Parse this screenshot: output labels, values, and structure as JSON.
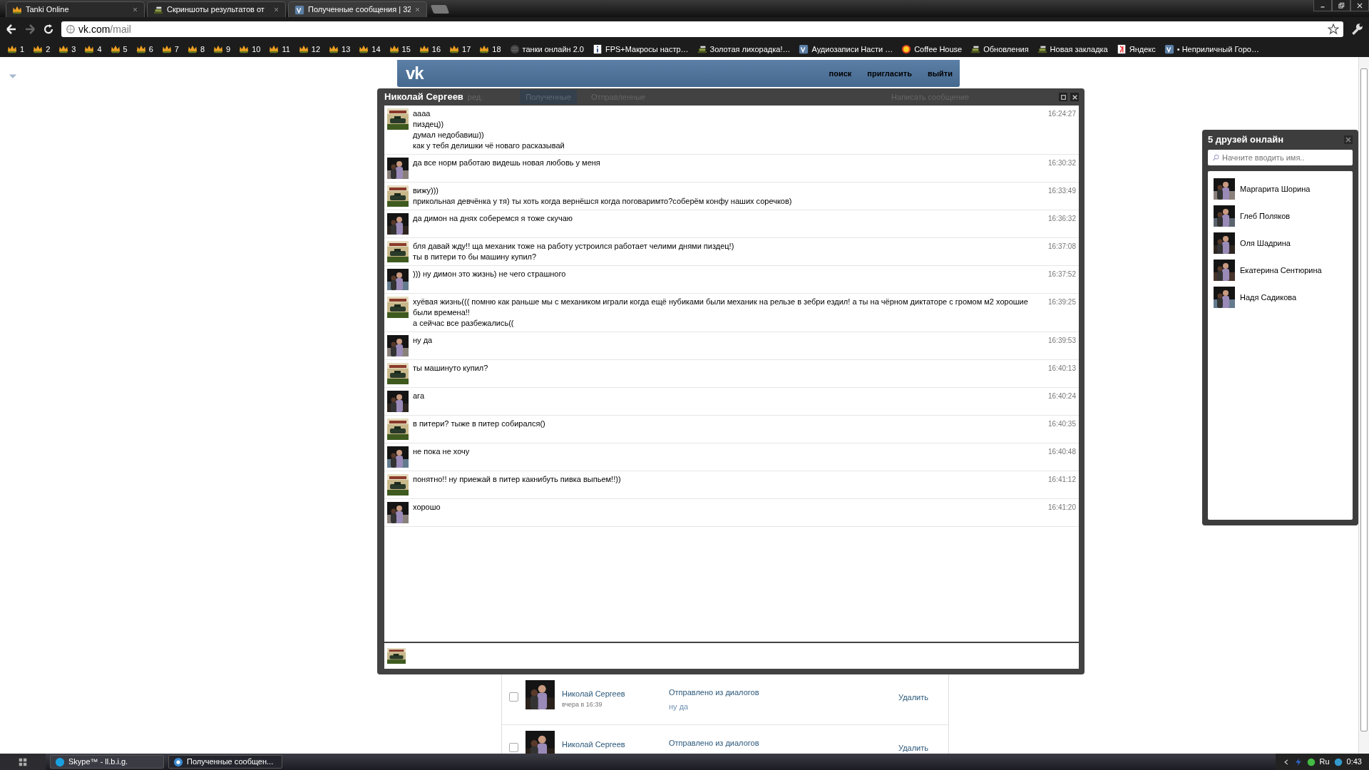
{
  "browser": {
    "tabs": [
      {
        "title": "Tanki Online",
        "kind": "crown",
        "selected": false
      },
      {
        "title": "Скриншоты результатов от",
        "kind": "tank",
        "selected": false
      },
      {
        "title": "Полученные сообщения | 32",
        "kind": "vk",
        "selected": true
      }
    ],
    "url": {
      "host": "vk.com",
      "path": "/mail"
    },
    "bookmarks": [
      {
        "label": "1",
        "kind": "crown"
      },
      {
        "label": "2",
        "kind": "crown"
      },
      {
        "label": "3",
        "kind": "crown"
      },
      {
        "label": "4",
        "kind": "crown"
      },
      {
        "label": "5",
        "kind": "crown"
      },
      {
        "label": "6",
        "kind": "crown"
      },
      {
        "label": "7",
        "kind": "crown"
      },
      {
        "label": "8",
        "kind": "crown"
      },
      {
        "label": "9",
        "kind": "crown"
      },
      {
        "label": "10",
        "kind": "crown"
      },
      {
        "label": "11",
        "kind": "crown"
      },
      {
        "label": "12",
        "kind": "crown"
      },
      {
        "label": "13",
        "kind": "crown"
      },
      {
        "label": "14",
        "kind": "crown"
      },
      {
        "label": "15",
        "kind": "crown"
      },
      {
        "label": "16",
        "kind": "crown"
      },
      {
        "label": "17",
        "kind": "crown"
      },
      {
        "label": "18",
        "kind": "crown"
      },
      {
        "label": "танки онлайн 2.0",
        "kind": "globe"
      },
      {
        "label": "FPS+Макросы настр…",
        "kind": "info"
      },
      {
        "label": "Золотая лихорадка!…",
        "kind": "tank"
      },
      {
        "label": "Аудиозаписи Насти …",
        "kind": "vk"
      },
      {
        "label": "Coffee House",
        "kind": "coffee"
      },
      {
        "label": "Обновления",
        "kind": "tank"
      },
      {
        "label": "Новая закладка",
        "kind": "tank"
      },
      {
        "label": "Яндекс",
        "kind": "yandex"
      },
      {
        "label": "• Неприличный Горо…",
        "kind": "vk"
      }
    ]
  },
  "vk_header": {
    "logo": "vk",
    "links": [
      "поиск",
      "пригласить",
      "выйти"
    ]
  },
  "behind_dialog": {
    "edit": "ред.",
    "tabs": [
      {
        "label": "Полученные",
        "selected": true
      },
      {
        "label": "Отправленные",
        "selected": false
      }
    ],
    "compose": "Написать сообщение"
  },
  "dialog": {
    "title": "Николай Сергеев",
    "messages": [
      {
        "kind": "mine",
        "lines": [
          "аааа",
          "пиздец))",
          "думал недобавиш))",
          "как у тебя делишки чё новаго расказывай"
        ],
        "time": "16:24:27"
      },
      {
        "kind": "theirs",
        "lines": [
          "да все норм работаю видешь новая любовь у меня"
        ],
        "time": "16:30:32"
      },
      {
        "kind": "mine",
        "lines": [
          "вижу)))",
          "прикольная девчёнка у тя) ты хоть когда вернёшся когда поговаримто?соберём конфу наших соречков)"
        ],
        "time": "16:33:49"
      },
      {
        "kind": "theirs",
        "lines": [
          "да димон на днях соберемся я тоже скучаю"
        ],
        "time": "16:36:32"
      },
      {
        "kind": "mine",
        "lines": [
          "бля давай жду!! ща механик тоже на работу устроился работает челими днями пиздец!)",
          "ты в питери то бы машину купил?"
        ],
        "time": "16:37:08"
      },
      {
        "kind": "theirs",
        "lines": [
          "))) ну димон это жизнь) не чего страшного"
        ],
        "time": "16:37:52"
      },
      {
        "kind": "mine",
        "lines": [
          "хуёвая жизнь((( помню как раньше мы с механиком играли когда ещё нубиками были механик на рельзе в зебри ездил! а ты на чёрном диктаторе с громом м2 хорошие были времена!!",
          "а сейчас все разбежались(("
        ],
        "time": "16:39:25"
      },
      {
        "kind": "theirs",
        "lines": [
          "ну да"
        ],
        "time": "16:39:53"
      },
      {
        "kind": "mine",
        "lines": [
          "ты машинуто купил?"
        ],
        "time": "16:40:13"
      },
      {
        "kind": "theirs",
        "lines": [
          "ага"
        ],
        "time": "16:40:24"
      },
      {
        "kind": "mine",
        "lines": [
          "в питери? тыже в питер собирался()"
        ],
        "time": "16:40:35"
      },
      {
        "kind": "theirs",
        "lines": [
          "не пока не хочу"
        ],
        "time": "16:40:48"
      },
      {
        "kind": "mine",
        "lines": [
          "понятно!! ну приежай в питер какнибуть пивка выпьем!!))"
        ],
        "time": "16:41:12"
      },
      {
        "kind": "theirs",
        "lines": [
          "хорошо"
        ],
        "time": "16:41:20"
      }
    ]
  },
  "friends_online": {
    "title": "5 друзей онлайн",
    "search_placeholder": "Начните вводить имя..",
    "friends": [
      "Маргарита Шорина",
      "Глеб Поляков",
      "Оля Шадрина",
      "Екатерина Сентюрина",
      "Надя Садикова"
    ]
  },
  "mail_list": [
    {
      "sender": "Николай Сергеев",
      "date": "вчера в 16:39",
      "subject": "Отправлено из диалогов",
      "preview": "ну да",
      "action": "Удалить",
      "checked": false
    },
    {
      "sender": "Николай Сергеев",
      "subject": "Отправлено из диалогов",
      "action": "Удалить",
      "checked": false
    }
  ],
  "taskbar": {
    "windows": [
      {
        "label": "Skype™ - ll.b.i.g.",
        "kind": "skype",
        "selected": false
      },
      {
        "label": "Полученные сообщен...",
        "kind": "chrome",
        "selected": true
      }
    ],
    "lang": "Ru",
    "clock": "0:43"
  }
}
